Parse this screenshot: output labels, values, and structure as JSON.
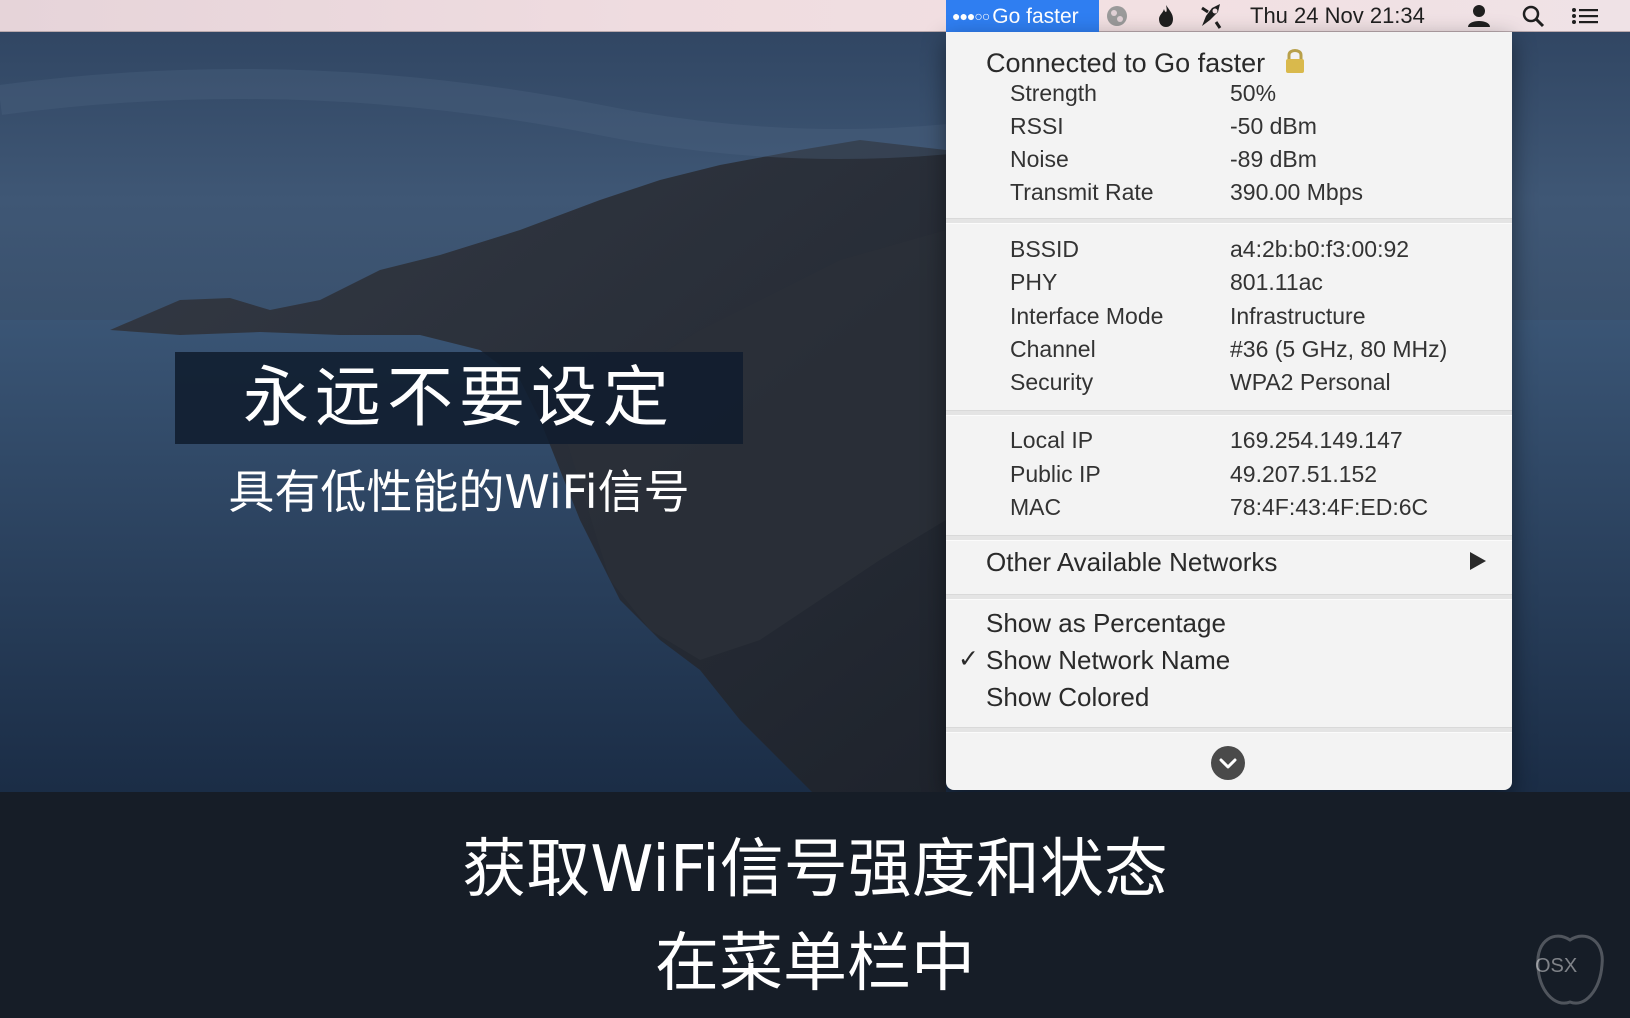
{
  "menubar": {
    "wifi_status": "Go faster",
    "wifi_dots": "●●●○○",
    "clock": "Thu 24 Nov  21:34",
    "icons": [
      "globe-icon",
      "flame-icon",
      "rocket-icon",
      "user-icon",
      "search-icon",
      "list-icon"
    ]
  },
  "wifi_menu": {
    "header": "Connected to Go faster",
    "signal": [
      {
        "label": "Strength",
        "value": "50%"
      },
      {
        "label": "RSSI",
        "value": "-50 dBm"
      },
      {
        "label": "Noise",
        "value": "-89 dBm"
      },
      {
        "label": "Transmit Rate",
        "value": "390.00 Mbps"
      }
    ],
    "network": [
      {
        "label": "BSSID",
        "value": "a4:2b:b0:f3:00:92"
      },
      {
        "label": "PHY",
        "value": "801.11ac"
      },
      {
        "label": "Interface Mode",
        "value": "Infrastructure"
      },
      {
        "label": "Channel",
        "value": "#36 (5 GHz, 80 MHz)"
      },
      {
        "label": "Security",
        "value": "WPA2 Personal"
      }
    ],
    "addresses": [
      {
        "label": "Local IP",
        "value": "169.254.149.147"
      },
      {
        "label": "Public IP",
        "value": "49.207.51.152"
      },
      {
        "label": "MAC",
        "value": "78:4F:43:4F:ED:6C"
      }
    ],
    "other_networks": "Other Available Networks",
    "options": {
      "show_percentage": "Show as Percentage",
      "show_network_name": "Show Network Name",
      "show_colored": "Show Colored",
      "checkmark": "✓"
    }
  },
  "captions": {
    "title": "永远不要设定",
    "subtitle": "具有低性能的WiFi信号",
    "bottom_line1": "获取WiFi信号强度和状态",
    "bottom_line2": "在菜单栏中"
  },
  "watermark": "OSX",
  "colors": {
    "accent": "#2f7ef1",
    "menu_bg": "#f3f3f3",
    "caption_bg": "#101c2d",
    "bottom_band": "#161d27"
  }
}
